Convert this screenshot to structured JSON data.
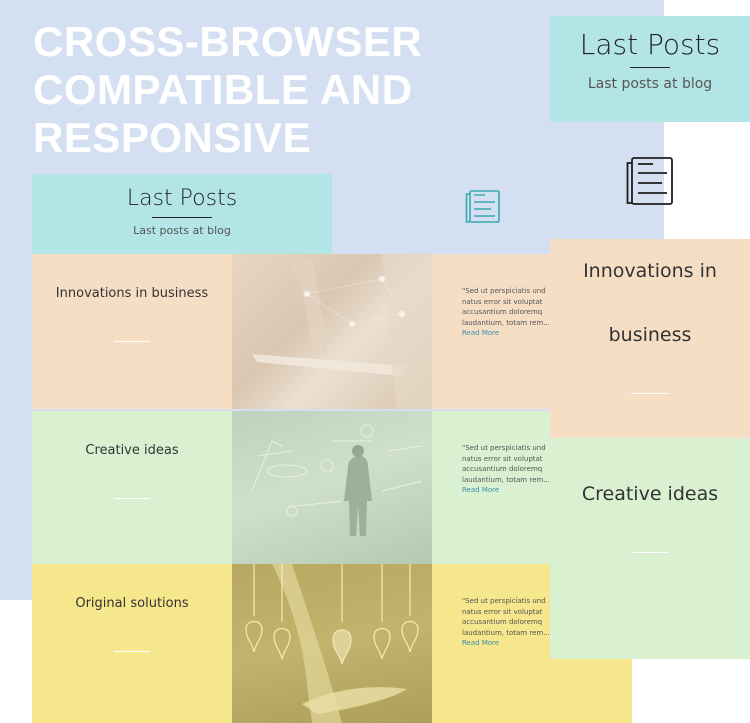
{
  "hero": {
    "lines": [
      "CROSS-BROWSER",
      "COMPATIBLE AND",
      "RESPONSIVE"
    ]
  },
  "colors": {
    "background": "#d4e0f1",
    "header": "#b3e5e6",
    "row_peach": "#f6dec5",
    "row_green": "#d9f1d1",
    "row_yellow": "#f6e68c",
    "link": "#3a8fb0",
    "icon_teal": "#3aa8b0"
  },
  "desktop": {
    "header": {
      "title": "Last Posts",
      "subtitle": "Last posts at blog"
    },
    "icon": "newspaper-icon",
    "posts": [
      {
        "title": "Innovations in business",
        "image": "hand-tablet-network-image",
        "excerpt_lines": [
          "\"Sed ut perspiciatis und",
          "natus error sit voluptat",
          "accusantium doloremq",
          "laudantium, totam rem..."
        ],
        "read_more": "Read More"
      },
      {
        "title": "Creative ideas",
        "image": "man-chalkboard-sketches-image",
        "excerpt_lines": [
          "\"Sed ut perspiciatis und",
          "natus error sit voluptat",
          "accusantium doloremq",
          "laudantium, totam rem..."
        ],
        "read_more": "Read More"
      },
      {
        "title": "Original solutions",
        "image": "hand-lightbulbs-image",
        "excerpt_lines": [
          "\"Sed ut perspiciatis und",
          "natus error sit voluptat",
          "accusantium doloremq",
          "laudantium, totam rem..."
        ],
        "read_more": "Read More"
      }
    ]
  },
  "mobile": {
    "header": {
      "title": "Last Posts",
      "subtitle": "Last posts at blog"
    },
    "icon": "newspaper-icon",
    "posts": [
      {
        "title_line1": "Innovations in",
        "title_line2": "business"
      },
      {
        "title": "Creative ideas"
      }
    ]
  }
}
